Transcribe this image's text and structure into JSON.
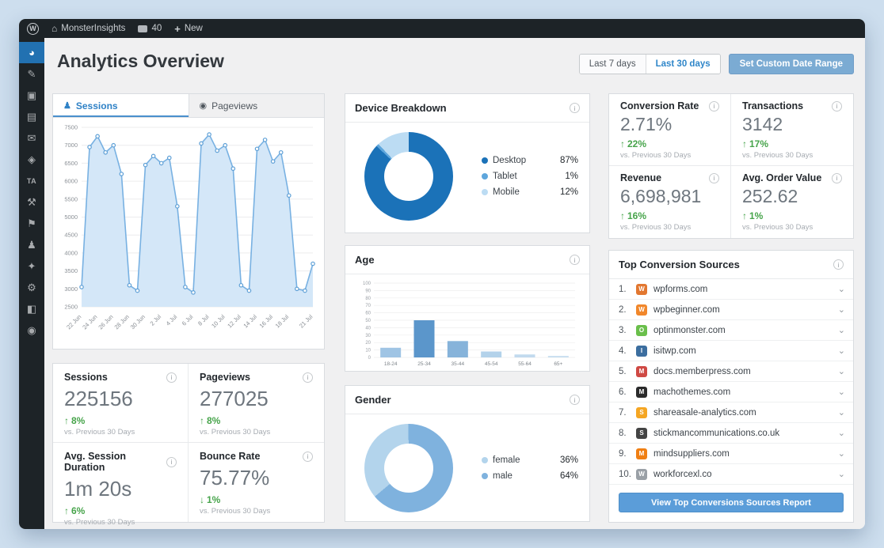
{
  "admin_bar": {
    "wp_logo": "W",
    "site_name": "MonsterInsights",
    "comments_count": "40",
    "new_label": "New"
  },
  "sidebar": {
    "items": [
      {
        "name": "monsterinsights",
        "glyph": "◕",
        "active": true,
        "text": false
      },
      {
        "name": "posts-pin",
        "glyph": "✎",
        "active": false,
        "text": false
      },
      {
        "name": "media",
        "glyph": "▣",
        "active": false,
        "text": false
      },
      {
        "name": "pages",
        "glyph": "▤",
        "active": false,
        "text": false
      },
      {
        "name": "comments",
        "glyph": "✉",
        "active": false,
        "text": false
      },
      {
        "name": "downloads",
        "glyph": "◈",
        "active": false,
        "text": false
      },
      {
        "name": "ta-menu",
        "glyph": "TA",
        "active": false,
        "text": true
      },
      {
        "name": "tools-hammer",
        "glyph": "⚒",
        "active": false,
        "text": false
      },
      {
        "name": "marketing-flag",
        "glyph": "⚑",
        "active": false,
        "text": false
      },
      {
        "name": "users",
        "glyph": "♟",
        "active": false,
        "text": false
      },
      {
        "name": "plugins",
        "glyph": "✦",
        "active": false,
        "text": false
      },
      {
        "name": "settings-gear",
        "glyph": "⚙",
        "active": false,
        "text": false
      },
      {
        "name": "memberships",
        "glyph": "◧",
        "active": false,
        "text": false
      },
      {
        "name": "video-play",
        "glyph": "◉",
        "active": false,
        "text": false
      }
    ]
  },
  "header": {
    "title": "Analytics Overview",
    "range_buttons": [
      {
        "label": "Last 7 days",
        "active": false
      },
      {
        "label": "Last 30 days",
        "active": true
      }
    ],
    "custom_range_label": "Set Custom Date Range"
  },
  "tabs": {
    "sessions": "Sessions",
    "pageviews": "Pageviews",
    "person_glyph": "♟",
    "eye_glyph": "◉"
  },
  "panels": {
    "device_title": "Device Breakdown",
    "age_title": "Age",
    "gender_title": "Gender"
  },
  "chart_data": [
    {
      "type": "line",
      "title": "Sessions",
      "x": [
        "22 Jun",
        "23 Jun",
        "24 Jun",
        "25 Jun",
        "26 Jun",
        "27 Jun",
        "28 Jun",
        "29 Jun",
        "30 Jun",
        "1 Jul",
        "2 Jul",
        "3 Jul",
        "4 Jul",
        "5 Jul",
        "6 Jul",
        "7 Jul",
        "8 Jul",
        "9 Jul",
        "10 Jul",
        "11 Jul",
        "12 Jul",
        "13 Jul",
        "14 Jul",
        "15 Jul",
        "16 Jul",
        "17 Jul",
        "18 Jul",
        "19 Jul",
        "20 Jul",
        "21 Jul"
      ],
      "values": [
        3050,
        6950,
        7250,
        6800,
        7000,
        6200,
        3100,
        2950,
        6450,
        6700,
        6500,
        6650,
        5300,
        3050,
        2900,
        7050,
        7300,
        6850,
        7000,
        6350,
        3100,
        2950,
        6900,
        7150,
        6550,
        6800,
        5600,
        3000,
        2950,
        3700
      ],
      "ylim": [
        2500,
        7500
      ],
      "ytick_step": 500,
      "xtick_indices": [
        0,
        2,
        4,
        6,
        8,
        10,
        12,
        14,
        16,
        18,
        20,
        22,
        24,
        26,
        29
      ],
      "line_color": "#78b1e2",
      "fill_color": "#d4e7f8",
      "grid": true,
      "legend_position": "none"
    },
    {
      "type": "pie",
      "title": "Device Breakdown",
      "labels": [
        "Desktop",
        "Tablet",
        "Mobile"
      ],
      "values": [
        87,
        1,
        12
      ],
      "colors": [
        "#1b72b8",
        "#5ea6dc",
        "#bcdcf3"
      ],
      "start_angle": 0,
      "legend_position": "right"
    },
    {
      "type": "bar",
      "title": "Age",
      "categories": [
        "18-24",
        "25-34",
        "35-44",
        "45-54",
        "55-64",
        "65+"
      ],
      "values": [
        13,
        50,
        22,
        8,
        4,
        2
      ],
      "colors": [
        "#9fc4e4",
        "#5b96cb",
        "#86b3da",
        "#b3d2ea",
        "#c2daee",
        "#c8def0"
      ],
      "ylim": [
        0,
        100
      ],
      "ytick_step": 10,
      "grid": true
    },
    {
      "type": "pie",
      "title": "Gender",
      "labels": [
        "female",
        "male"
      ],
      "values": [
        36,
        64
      ],
      "colors": [
        "#b3d4ec",
        "#7fb2de"
      ],
      "start_angle": 230,
      "legend_position": "right"
    }
  ],
  "kpis": {
    "items": [
      {
        "title": "Sessions",
        "value": "225156",
        "arrow": "↑",
        "pct": "8%",
        "compare": "vs. Previous 30 Days"
      },
      {
        "title": "Pageviews",
        "value": "277025",
        "arrow": "↑",
        "pct": "8%",
        "compare": "vs. Previous 30 Days"
      },
      {
        "title": "Avg. Session Duration",
        "value": "1m 20s",
        "arrow": "↑",
        "pct": "6%",
        "compare": "vs. Previous 30 Days"
      },
      {
        "title": "Bounce Rate",
        "value": "75.77%",
        "arrow": "↓",
        "pct": "1%",
        "compare": "vs. Previous 30 Days"
      }
    ]
  },
  "metrics": {
    "items": [
      {
        "title": "Conversion Rate",
        "value": "2.71%",
        "arrow": "↑",
        "pct": "22%",
        "compare": "vs. Previous 30 Days"
      },
      {
        "title": "Transactions",
        "value": "3142",
        "arrow": "↑",
        "pct": "17%",
        "compare": "vs. Previous 30 Days"
      },
      {
        "title": "Revenue",
        "value": "6,698,981",
        "arrow": "↑",
        "pct": "16%",
        "compare": "vs. Previous 30 Days"
      },
      {
        "title": "Avg. Order Value",
        "value": "252.62",
        "arrow": "↑",
        "pct": "1%",
        "compare": "vs. Previous 30 Days"
      }
    ]
  },
  "top_sources": {
    "title": "Top Conversion Sources",
    "chevron_glyph": "⌄",
    "items": [
      {
        "rank": "1.",
        "domain": "wpforms.com",
        "initial": "W",
        "color": "#e27730"
      },
      {
        "rank": "2.",
        "domain": "wpbeginner.com",
        "initial": "W",
        "color": "#f1872b"
      },
      {
        "rank": "3.",
        "domain": "optinmonster.com",
        "initial": "O",
        "color": "#6abf4b"
      },
      {
        "rank": "4.",
        "domain": "isitwp.com",
        "initial": "I",
        "color": "#3c6e9f"
      },
      {
        "rank": "5.",
        "domain": "docs.memberpress.com",
        "initial": "M",
        "color": "#cf4944"
      },
      {
        "rank": "6.",
        "domain": "machothemes.com",
        "initial": "M",
        "color": "#2b2b2b"
      },
      {
        "rank": "7.",
        "domain": "shareasale-analytics.com",
        "initial": "S",
        "color": "#f5a623"
      },
      {
        "rank": "8.",
        "domain": "stickmancommunications.co.uk",
        "initial": "S",
        "color": "#444444"
      },
      {
        "rank": "9.",
        "domain": "mindsuppliers.com",
        "initial": "M",
        "color": "#f07f13"
      },
      {
        "rank": "10.",
        "domain": "workforcexl.co",
        "initial": "W",
        "color": "#9aa0a6"
      }
    ],
    "button_label": "View Top Conversions Sources Report"
  }
}
